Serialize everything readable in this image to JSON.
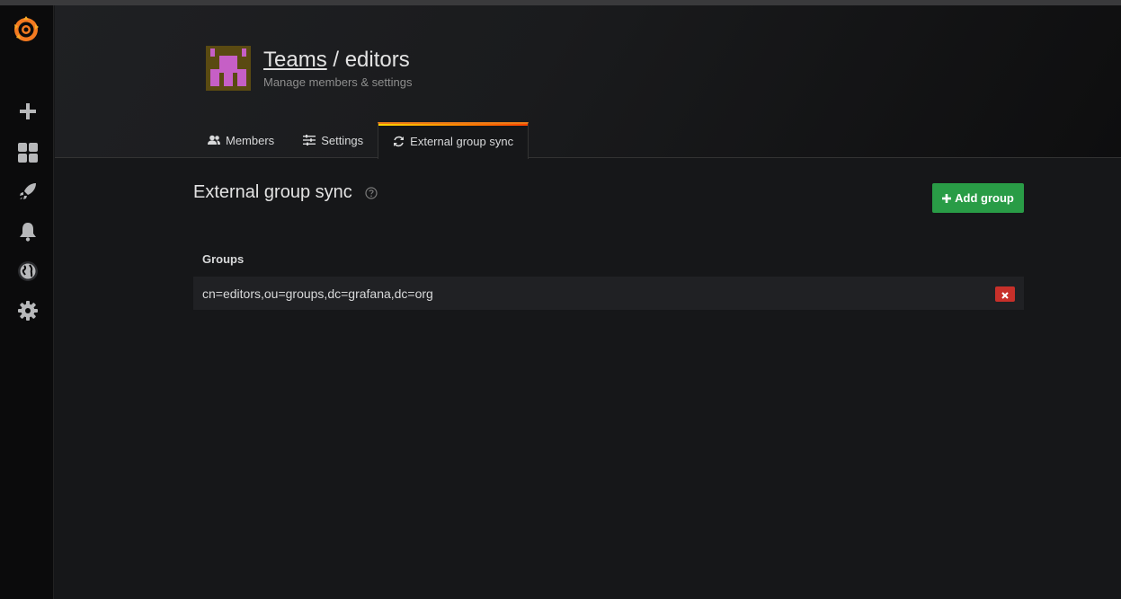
{
  "colors": {
    "accent_orange": "#eb7b18",
    "add_button_green": "#299c46",
    "delete_button_red": "#c7302a",
    "background": "#161719"
  },
  "sidebar": {
    "items": [
      {
        "name": "grafana-logo-icon"
      },
      {
        "name": "plus-icon"
      },
      {
        "name": "dashboards-icon"
      },
      {
        "name": "explore-rocket-icon"
      },
      {
        "name": "alerting-bell-icon"
      },
      {
        "name": "globe-icon"
      },
      {
        "name": "gear-icon"
      }
    ]
  },
  "header": {
    "breadcrumb_link": "Teams",
    "separator": "/",
    "team_name": "editors",
    "subtitle": "Manage members & settings"
  },
  "tabs": [
    {
      "label": "Members",
      "icon": "users-icon",
      "active": false
    },
    {
      "label": "Settings",
      "icon": "sliders-icon",
      "active": false
    },
    {
      "label": "External group sync",
      "icon": "sync-icon",
      "active": true
    }
  ],
  "main": {
    "title": "External group sync",
    "add_button_label": "Add group",
    "groups_header": "Groups",
    "groups": [
      {
        "value": "cn=editors,ou=groups,dc=grafana,dc=org"
      }
    ]
  }
}
